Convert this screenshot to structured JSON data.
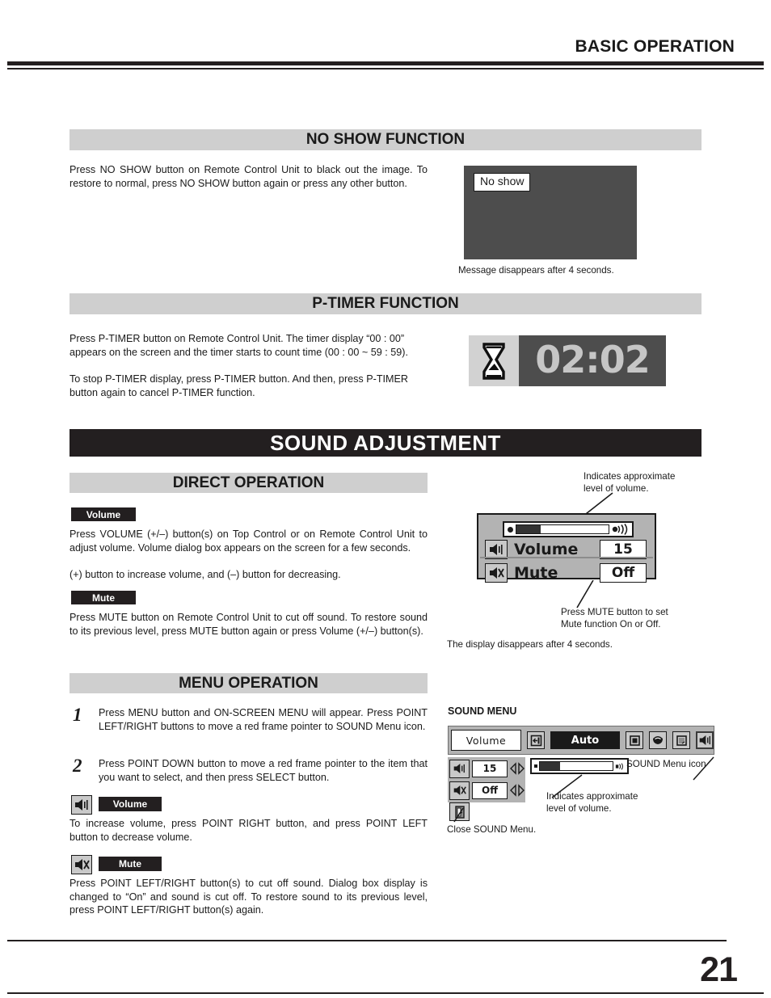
{
  "header": {
    "title": "BASIC OPERATION"
  },
  "no_show": {
    "banner": "NO SHOW FUNCTION",
    "body": "Press NO SHOW button on Remote Control Unit to black out the image.  To restore to normal, press NO SHOW button again or press any other button.",
    "screen_message": "No show",
    "caption": "Message disappears after 4 seconds."
  },
  "p_timer": {
    "banner": "P-TIMER FUNCTION",
    "body_line1": "Press P-TIMER button on Remote Control Unit.  The timer display “00 : 00” appears on the screen and the timer starts to count time (00 : 00 ~ 59 : 59).",
    "body_line2": "To stop P-TIMER display, press P-TIMER button.  And then, press P-TIMER button again to cancel P-TIMER function.",
    "display_value": "02:02",
    "icon": "hourglass-icon"
  },
  "sound_adjustment": {
    "banner": "SOUND ADJUSTMENT"
  },
  "direct_operation": {
    "banner": "DIRECT OPERATION",
    "volume_pill": "Volume",
    "volume_body": "Press VOLUME (+/–) button(s) on Top Control or on Remote Control Unit to adjust volume.  Volume dialog box appears on the screen for a few seconds.",
    "volume_body2": "(+) button to increase volume, and (–) button for decreasing.",
    "mute_pill": "Mute",
    "mute_body": "Press MUTE button on Remote Control Unit to cut off sound.  To restore sound to its previous level, press MUTE button again or press Volume (+/–) button(s)."
  },
  "volume_dialog": {
    "annotation_top": "Indicates approximate\nlevel of volume.",
    "annotation_top_line1": "Indicates approximate",
    "annotation_top_line2": "level of volume.",
    "volume_label": "Volume",
    "volume_value": "15",
    "mute_label": "Mute",
    "mute_value": "Off",
    "annotation_bottom_line1": "Press MUTE button to set",
    "annotation_bottom_line2": "Mute function On or Off.",
    "caption": "The display disappears after 4 seconds.",
    "slider_fill_percent": 26
  },
  "menu_operation": {
    "banner": "MENU OPERATION",
    "steps": [
      {
        "number": "1",
        "text": "Press MENU button and ON-SCREEN MENU will appear.  Press POINT LEFT/RIGHT buttons to move a red frame pointer to SOUND Menu icon."
      },
      {
        "number": "2",
        "text": "Press POINT DOWN button to move a red frame pointer to the item that you want to select, and then press SELECT button."
      }
    ],
    "volume_pill": "Volume",
    "volume_body": "To increase volume, press POINT RIGHT button, and press POINT LEFT button to decrease volume.",
    "mute_pill": "Mute",
    "mute_body": "Press POINT LEFT/RIGHT button(s) to cut off sound.  Dialog box display is changed to “On” and sound is cut off.  To restore sound to its previous level, press POINT LEFT/RIGHT button(s) again."
  },
  "sound_menu": {
    "heading": "SOUND MENU",
    "title_box": "Volume",
    "auto_label": "Auto",
    "menu_icons": [
      "input-icon",
      "screen-icon",
      "color-adjust-icon",
      "image-icon",
      "sound-icon"
    ],
    "items": [
      {
        "icon": "volume-icon",
        "value": "15"
      },
      {
        "icon": "mute-icon",
        "value": "Off"
      }
    ],
    "exit_icon": "exit-door-icon",
    "slider_fill_percent": 28,
    "annotation_sound_icon": "SOUND Menu icon",
    "annotation_level_line1": "Indicates approximate",
    "annotation_level_line2": "level of volume.",
    "annotation_close": "Close SOUND Menu."
  },
  "footer": {
    "page_number": "21"
  },
  "colors": {
    "banner_gray": "#cfcfcf",
    "banner_black": "#231f20",
    "screen_gray": "#4d4d4d",
    "menu_gray": "#b3b3b3"
  }
}
